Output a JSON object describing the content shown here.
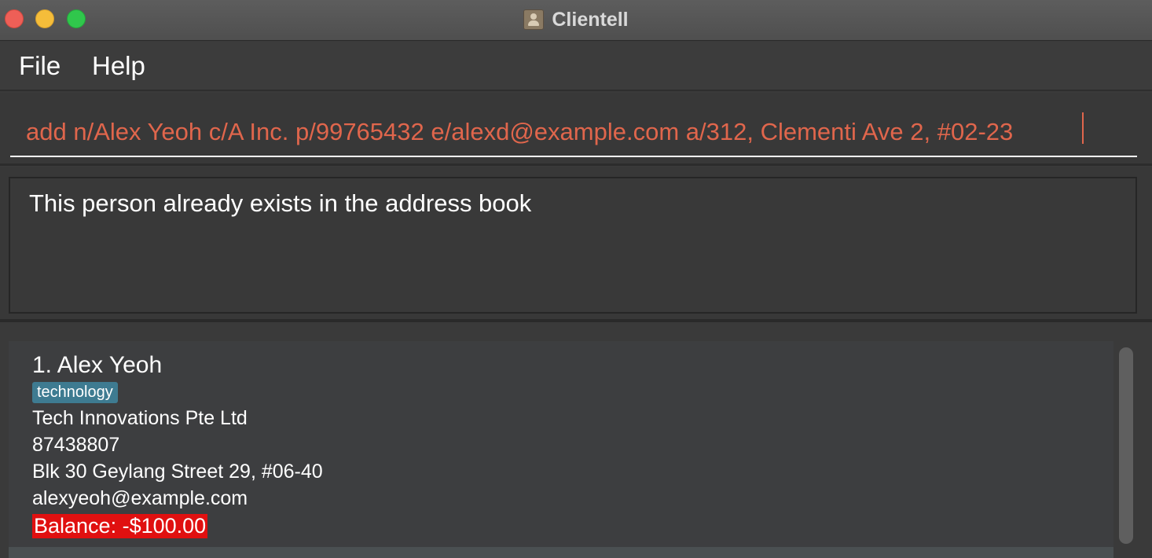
{
  "window": {
    "title": "Clientell",
    "app_icon": "contact-book-icon",
    "traffic_lights": [
      "close",
      "minimize",
      "maximize"
    ]
  },
  "menu": {
    "file": "File",
    "help": "Help"
  },
  "command_box": {
    "value": "add n/Alex Yeoh c/A Inc. p/99765432 e/alexd@example.com a/312, Clementi Ave 2, #02-23",
    "text_color": "#e0664c"
  },
  "result": {
    "message": "This person already exists in the address book"
  },
  "person_list": [
    {
      "index_name": "1. Alex Yeoh",
      "tags": [
        "technology"
      ],
      "company": "Tech Innovations Pte Ltd",
      "phone": "87438807",
      "address": "Blk 30 Geylang Street 29, #06-40",
      "email": "alexyeoh@example.com",
      "balance": "Balance: -$100.00",
      "balance_color": "#e01010",
      "tag_color": "#3e7b91"
    }
  ]
}
